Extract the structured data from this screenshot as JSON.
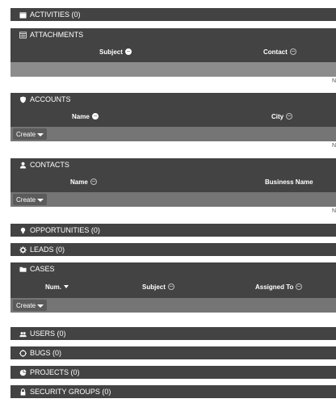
{
  "panels": {
    "activities": {
      "title": "ACTIVITIES (0)",
      "icon": "calendar-icon"
    },
    "attachments": {
      "title": "ATTACHMENTS",
      "icon": "grid-calendar-icon",
      "columns": [
        "Subject",
        "Contact"
      ],
      "footer_text": "N"
    },
    "accounts": {
      "title": "ACCOUNTS",
      "icon": "shield-icon",
      "columns": [
        "Name",
        "City"
      ],
      "create_label": "Create",
      "footer_text": "N"
    },
    "contacts": {
      "title": "CONTACTS",
      "icon": "person-icon",
      "columns": [
        "Name",
        "Business Name"
      ],
      "create_label": "Create",
      "footer_text": "N"
    },
    "opportunities": {
      "title": "OPPORTUNITIES (0)",
      "icon": "lightbulb-icon"
    },
    "leads": {
      "title": "LEADS (0)",
      "icon": "gear-icon"
    },
    "cases": {
      "title": "CASES",
      "icon": "folder-icon",
      "columns": [
        "Num.",
        "Subject",
        "Assigned To"
      ],
      "create_label": "Create"
    },
    "users": {
      "title": "USERS (0)",
      "icon": "users-icon"
    },
    "bugs": {
      "title": "BUGS (0)",
      "icon": "bug-icon"
    },
    "projects": {
      "title": "PROJECTS (0)",
      "icon": "pie-chart-icon"
    },
    "security_groups": {
      "title": "SECURITY GROUPS (0)",
      "icon": "lock-icon"
    }
  },
  "colors": {
    "header_bg": "#434343",
    "action_bg": "#757575",
    "button_bg": "#5b5b5b"
  }
}
